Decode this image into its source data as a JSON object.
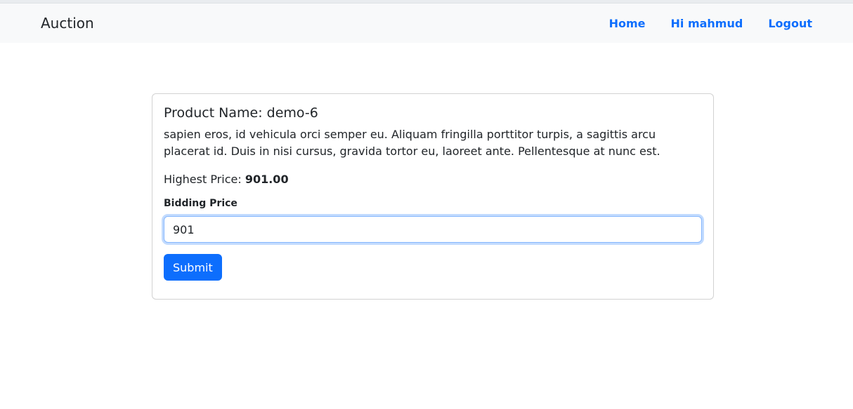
{
  "navbar": {
    "brand": "Auction",
    "links": [
      {
        "label": "Home"
      },
      {
        "label": "Hi mahmud"
      },
      {
        "label": "Logout"
      }
    ]
  },
  "product": {
    "title": "Product Name: demo-6",
    "description": "sapien eros, id vehicula orci semper eu. Aliquam fringilla porttitor turpis, a sagittis arcu placerat id. Duis in nisi cursus, gravida tortor eu, laoreet ante. Pellentesque at nunc est.",
    "highest_price_label": "Highest Price:",
    "highest_price_value": "901.00"
  },
  "bid_form": {
    "label": "Bidding Price",
    "value": "901",
    "submit_label": "Submit"
  },
  "colors": {
    "accent": "#0d6efd",
    "navbar_bg": "#f8f9fa"
  }
}
